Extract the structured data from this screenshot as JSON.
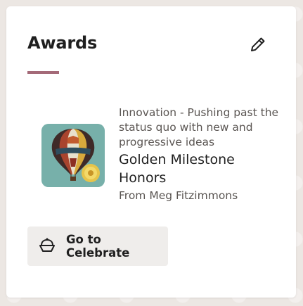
{
  "card": {
    "title": "Awards",
    "edit_icon": "pencil-icon"
  },
  "award": {
    "image_icon": "hot-air-balloon-image",
    "category": "Innovation - Pushing past the status quo with new and progressive ideas",
    "name": "Golden Milestone Honors",
    "from": "From Meg Fitzimmons"
  },
  "celebrate": {
    "label": "Go to Celebrate",
    "icon": "cupcake-icon"
  },
  "colors": {
    "accent": "#a46a78",
    "button_bg": "#efedeb",
    "page_bg": "#ece7e3"
  }
}
